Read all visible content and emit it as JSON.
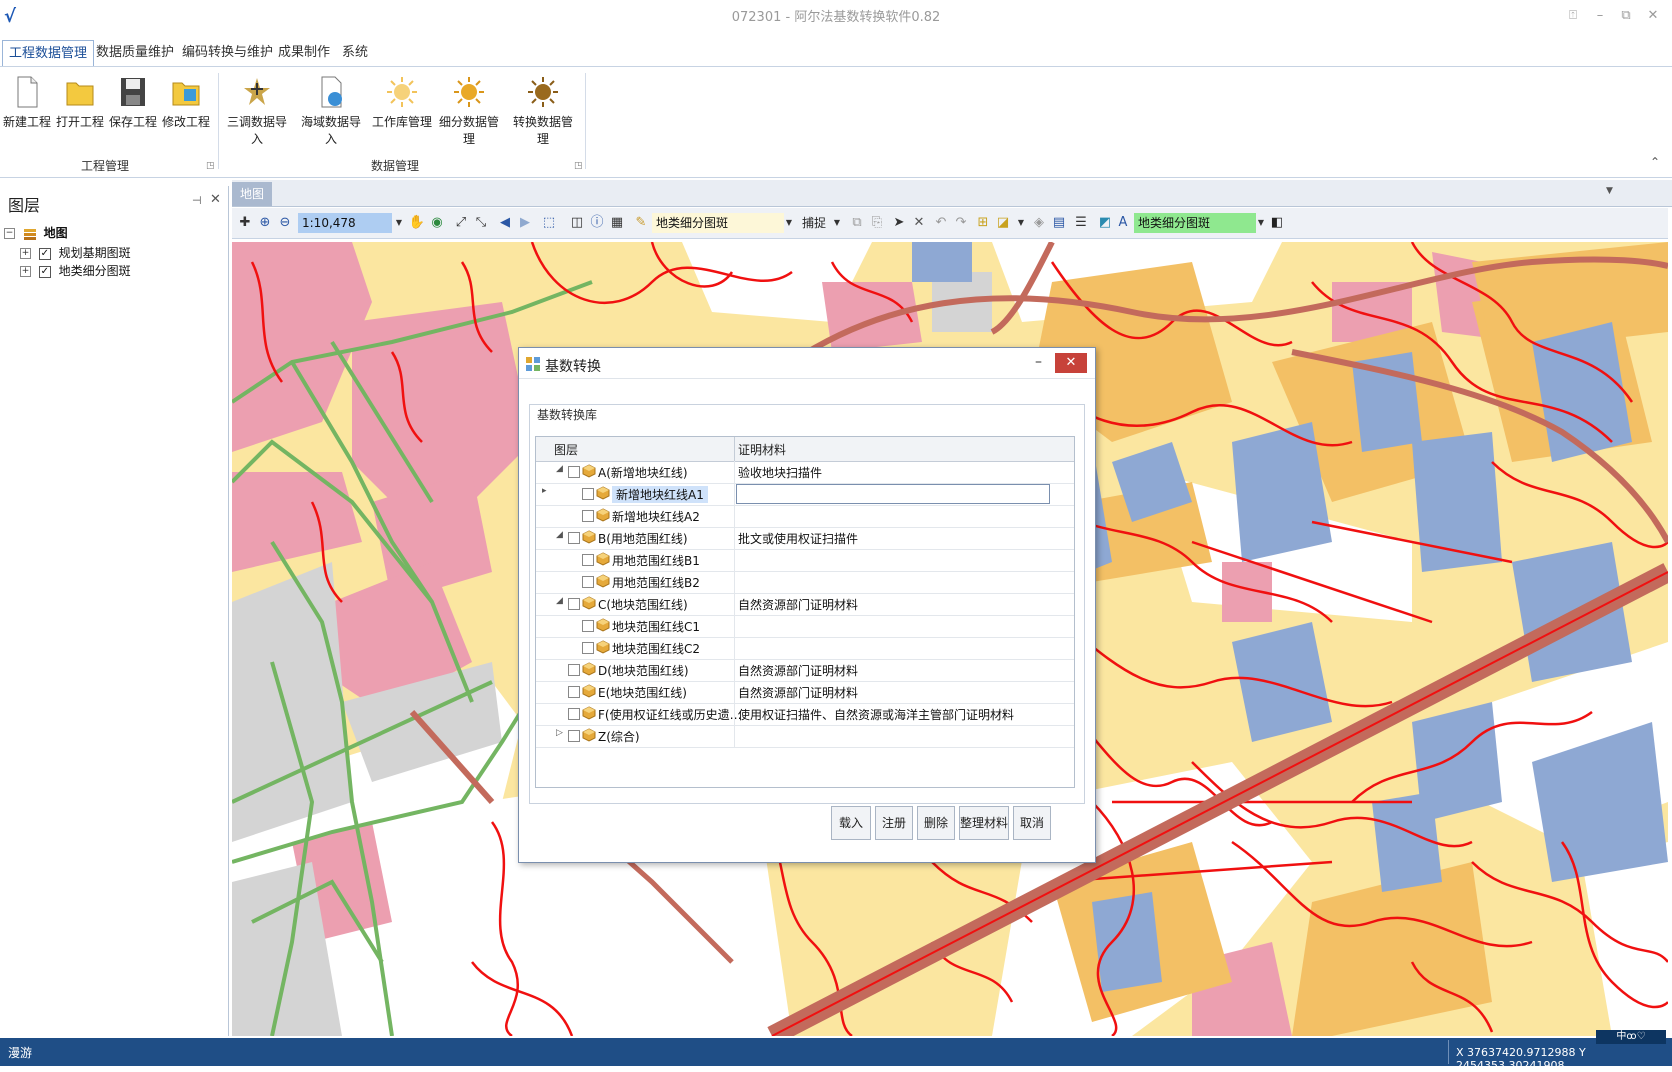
{
  "window": {
    "title": "072301 - 阿尔法基数转换软件0.82",
    "logo": "√",
    "controls": [
      "⍐",
      "–",
      "⧉",
      "✕"
    ]
  },
  "ribbon": {
    "tabs": [
      "工程数据管理",
      "数据质量维护",
      "编码转换与维护",
      "成果制作",
      "系统"
    ],
    "active_tab": 0,
    "groups": [
      {
        "label": "工程管理",
        "buttons": [
          "新建工程",
          "打开工程",
          "保存工程",
          "修改工程"
        ]
      },
      {
        "label": "数据管理",
        "buttons": [
          "三调数据导入",
          "海域数据导入",
          "工作库管理",
          "细分数据管理",
          "转换数据管理"
        ]
      }
    ],
    "collapse_glyph": "⌃"
  },
  "layers_panel": {
    "title": "图层",
    "pin_glyph": "⊣",
    "close_glyph": "✕",
    "root": "地图",
    "items": [
      "规划基期图斑",
      "地类细分图斑"
    ]
  },
  "document_tab": "地图",
  "map_toolbar": {
    "scale": "1:10,478",
    "layer_select": "地类细分图斑",
    "snap_label": "捕捉",
    "layer_select_2": "地类细分图斑"
  },
  "statusbar": {
    "mode": "漫游",
    "coordinates": "X 37637420.9712988  Y 2454353.30241908",
    "tray": "中ꝏ♡"
  },
  "dialog": {
    "title": "基数转换",
    "group_label": "基数转换库",
    "columns": [
      "图层",
      "证明材料"
    ],
    "rows": [
      {
        "level": 0,
        "expand": "◢",
        "layer": "A(新增地块红线)",
        "material": "验收地块扫描件"
      },
      {
        "level": 1,
        "expand": "",
        "layer": "新增地块红线A1",
        "material": "",
        "selected": true
      },
      {
        "level": 1,
        "expand": "",
        "layer": "新增地块红线A2",
        "material": ""
      },
      {
        "level": 0,
        "expand": "◢",
        "layer": "B(用地范围红线)",
        "material": "批文或使用权证扫描件"
      },
      {
        "level": 1,
        "expand": "",
        "layer": "用地范围红线B1",
        "material": ""
      },
      {
        "level": 1,
        "expand": "",
        "layer": "用地范围红线B2",
        "material": ""
      },
      {
        "level": 0,
        "expand": "◢",
        "layer": "C(地块范围红线)",
        "material": "自然资源部门证明材料"
      },
      {
        "level": 1,
        "expand": "",
        "layer": "地块范围红线C1",
        "material": ""
      },
      {
        "level": 1,
        "expand": "",
        "layer": "地块范围红线C2",
        "material": ""
      },
      {
        "level": 0,
        "expand": "",
        "layer": "D(地块范围红线)",
        "material": "自然资源部门证明材料"
      },
      {
        "level": 0,
        "expand": "",
        "layer": "E(地块范围红线)",
        "material": "自然资源部门证明材料"
      },
      {
        "level": 0,
        "expand": "",
        "layer": "F(使用权证红线或历史遗…",
        "material": "使用权证扫描件、自然资源或海洋主管部门证明材料"
      },
      {
        "level": 0,
        "expand": "▷",
        "layer": "Z(综合)",
        "material": ""
      }
    ],
    "buttons": [
      "载入",
      "注册",
      "删除",
      "整理材料",
      "取消"
    ]
  },
  "colors": {
    "pink": "#ec9fb0",
    "yellow": "#f7e49a",
    "orange": "#f3c065",
    "blue": "#8ea8d3",
    "green": "#74b562",
    "gray": "#d4d4d4",
    "red_line": "#f01010",
    "road": "#c36a5c"
  }
}
